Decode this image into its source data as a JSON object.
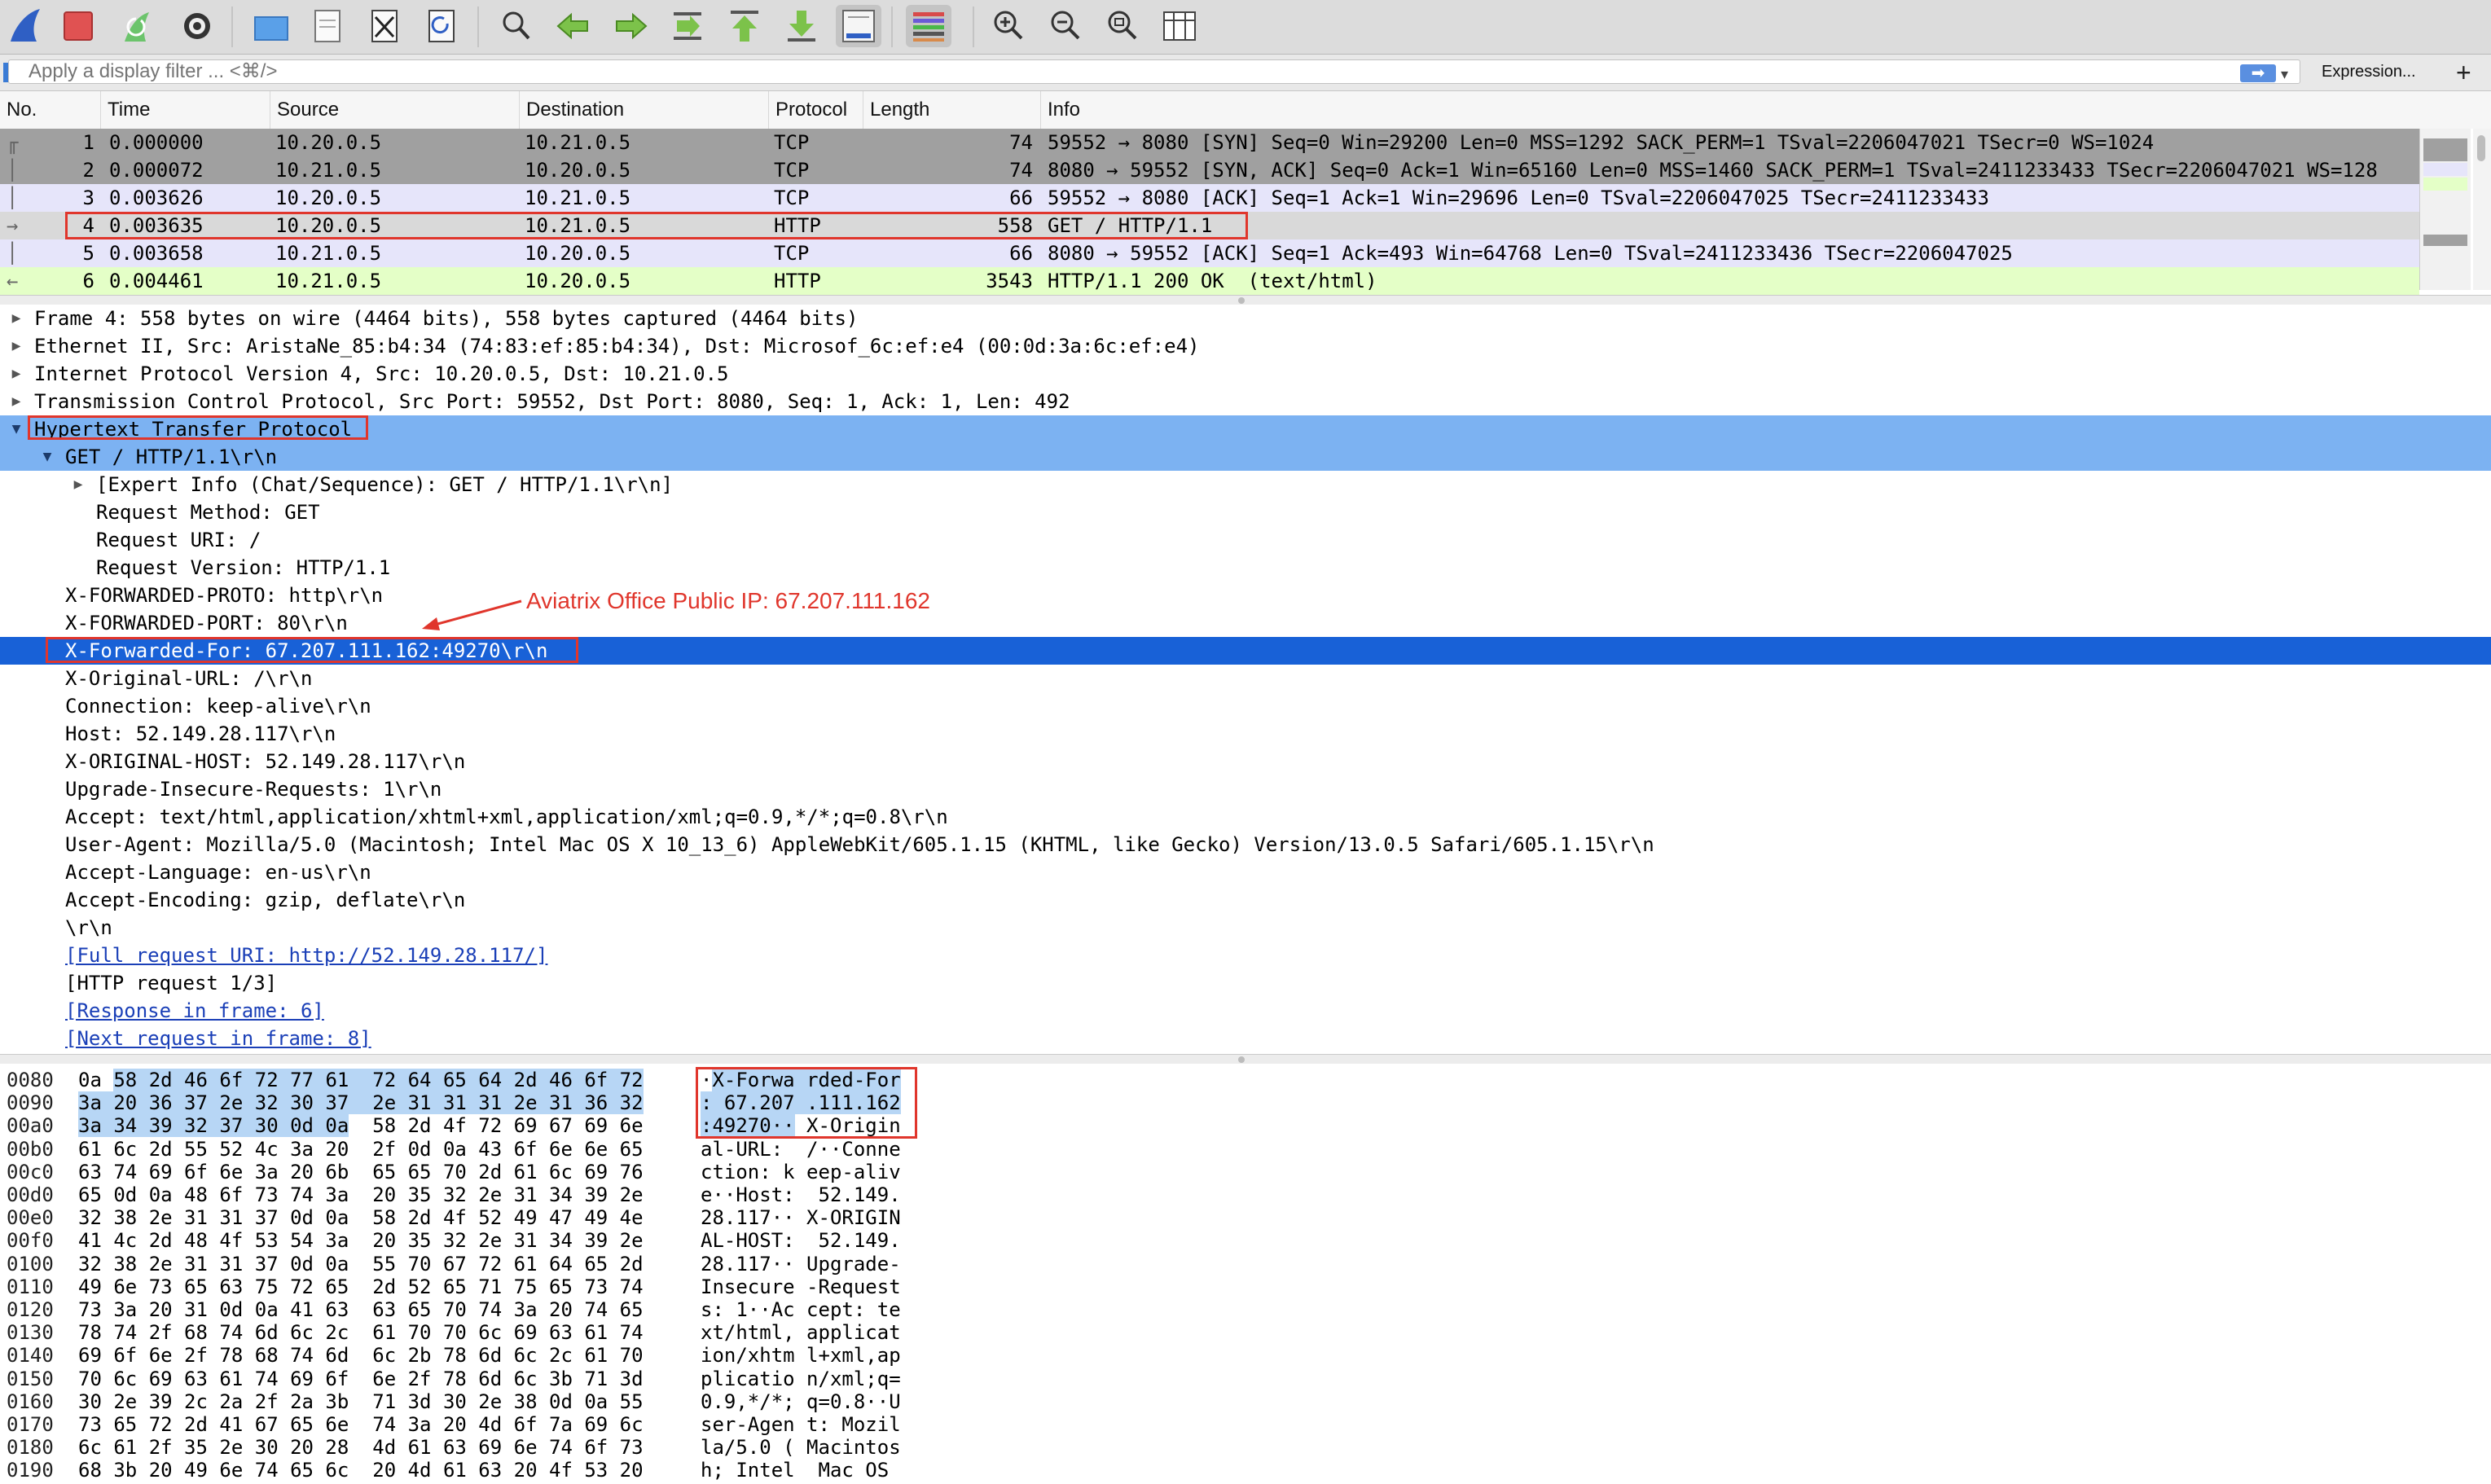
{
  "toolbar": {
    "buttons": [
      {
        "name": "shark-fin-start-icon"
      },
      {
        "name": "stop-capture-icon"
      },
      {
        "name": "restart-capture-icon"
      },
      {
        "name": "capture-options-icon"
      },
      {
        "name": "open-file-icon"
      },
      {
        "name": "save-file-icon"
      },
      {
        "name": "close-file-icon"
      },
      {
        "name": "reload-file-icon"
      },
      {
        "name": "find-packet-icon"
      },
      {
        "name": "go-back-icon"
      },
      {
        "name": "go-forward-icon"
      },
      {
        "name": "go-to-packet-icon"
      },
      {
        "name": "first-packet-icon"
      },
      {
        "name": "last-packet-icon"
      },
      {
        "name": "autoscroll-icon"
      },
      {
        "name": "colorize-icon"
      },
      {
        "name": "zoom-in-icon"
      },
      {
        "name": "zoom-out-icon"
      },
      {
        "name": "normal-size-icon"
      },
      {
        "name": "resize-columns-icon"
      }
    ]
  },
  "filter": {
    "placeholder": "Apply a display filter ... <⌘/>",
    "apply_label": "➡",
    "dropdown": "▾",
    "expression_label": "Expression...",
    "add_label": "+"
  },
  "packet_list": {
    "columns": [
      "No.",
      "Time",
      "Source",
      "Destination",
      "Protocol",
      "Length",
      "Info"
    ],
    "rows": [
      {
        "no": "1",
        "time": "0.000000",
        "src": "10.20.0.5",
        "dst": "10.21.0.5",
        "proto": "TCP",
        "len": "74",
        "info": "59552 → 8080 [SYN] Seq=0 Win=29200 Len=0 MSS=1292 SACK_PERM=1 TSval=2206047021 TSecr=0 WS=1024",
        "bg": "#a0a0a0",
        "marker": "╓"
      },
      {
        "no": "2",
        "time": "0.000072",
        "src": "10.21.0.5",
        "dst": "10.20.0.5",
        "proto": "TCP",
        "len": "74",
        "info": "8080 → 59552 [SYN, ACK] Seq=0 Ack=1 Win=65160 Len=0 MSS=1460 SACK_PERM=1 TSval=2411233433 TSecr=2206047021 WS=128",
        "bg": "#a0a0a0",
        "marker": "│"
      },
      {
        "no": "3",
        "time": "0.003626",
        "src": "10.20.0.5",
        "dst": "10.21.0.5",
        "proto": "TCP",
        "len": "66",
        "info": "59552 → 8080 [ACK] Seq=1 Ack=1 Win=29696 Len=0 TSval=2206047025 TSecr=2411233433",
        "bg": "#e6e5fa",
        "marker": "│"
      },
      {
        "no": "4",
        "time": "0.003635",
        "src": "10.20.0.5",
        "dst": "10.21.0.5",
        "proto": "HTTP",
        "len": "558",
        "info": "GET / HTTP/1.1",
        "bg": "#d9d9d9",
        "marker": "→"
      },
      {
        "no": "5",
        "time": "0.003658",
        "src": "10.21.0.5",
        "dst": "10.20.0.5",
        "proto": "TCP",
        "len": "66",
        "info": "8080 → 59552 [ACK] Seq=1 Ack=493 Win=64768 Len=0 TSval=2411233436 TSecr=2206047025",
        "bg": "#e6e5fa",
        "marker": "│"
      },
      {
        "no": "6",
        "time": "0.004461",
        "src": "10.21.0.5",
        "dst": "10.20.0.5",
        "proto": "HTTP",
        "len": "3543",
        "info": "HTTP/1.1 200 OK  (text/html)",
        "bg": "#e4ffc7",
        "marker": "←"
      }
    ]
  },
  "details": [
    {
      "indent": 0,
      "tri": "▶",
      "text": "Frame 4: 558 bytes on wire (4464 bits), 558 bytes captured (4464 bits)"
    },
    {
      "indent": 0,
      "tri": "▶",
      "text": "Ethernet II, Src: AristaNe_85:b4:34 (74:83:ef:85:b4:34), Dst: Microsof_6c:ef:e4 (00:0d:3a:6c:ef:e4)"
    },
    {
      "indent": 0,
      "tri": "▶",
      "text": "Internet Protocol Version 4, Src: 10.20.0.5, Dst: 10.21.0.5"
    },
    {
      "indent": 0,
      "tri": "▶",
      "text": "Transmission Control Protocol, Src Port: 59552, Dst Port: 8080, Seq: 1, Ack: 1, Len: 492"
    },
    {
      "indent": 0,
      "tri": "▼",
      "text": "Hypertext Transfer Protocol",
      "sel": "sel1"
    },
    {
      "indent": 1,
      "tri": "▼",
      "text": "GET / HTTP/1.1\\r\\n",
      "sel": "sel1"
    },
    {
      "indent": 2,
      "tri": "▶",
      "text": "[Expert Info (Chat/Sequence): GET / HTTP/1.1\\r\\n]"
    },
    {
      "indent": 2,
      "tri": "",
      "text": "Request Method: GET"
    },
    {
      "indent": 2,
      "tri": "",
      "text": "Request URI: /"
    },
    {
      "indent": 2,
      "tri": "",
      "text": "Request Version: HTTP/1.1"
    },
    {
      "indent": 1,
      "tri": "",
      "text": "X-FORWARDED-PROTO: http\\r\\n"
    },
    {
      "indent": 1,
      "tri": "",
      "text": "X-FORWARDED-PORT: 80\\r\\n"
    },
    {
      "indent": 1,
      "tri": "",
      "text": "X-Forwarded-For: 67.207.111.162:49270\\r\\n",
      "sel": "sel2"
    },
    {
      "indent": 1,
      "tri": "",
      "text": "X-Original-URL: /\\r\\n"
    },
    {
      "indent": 1,
      "tri": "",
      "text": "Connection: keep-alive\\r\\n"
    },
    {
      "indent": 1,
      "tri": "",
      "text": "Host: 52.149.28.117\\r\\n"
    },
    {
      "indent": 1,
      "tri": "",
      "text": "X-ORIGINAL-HOST: 52.149.28.117\\r\\n"
    },
    {
      "indent": 1,
      "tri": "",
      "text": "Upgrade-Insecure-Requests: 1\\r\\n"
    },
    {
      "indent": 1,
      "tri": "",
      "text": "Accept: text/html,application/xhtml+xml,application/xml;q=0.9,*/*;q=0.8\\r\\n"
    },
    {
      "indent": 1,
      "tri": "",
      "text": "User-Agent: Mozilla/5.0 (Macintosh; Intel Mac OS X 10_13_6) AppleWebKit/605.1.15 (KHTML, like Gecko) Version/13.0.5 Safari/605.1.15\\r\\n"
    },
    {
      "indent": 1,
      "tri": "",
      "text": "Accept-Language: en-us\\r\\n"
    },
    {
      "indent": 1,
      "tri": "",
      "text": "Accept-Encoding: gzip, deflate\\r\\n"
    },
    {
      "indent": 1,
      "tri": "",
      "text": "\\r\\n"
    },
    {
      "indent": 1,
      "tri": "",
      "text": "[Full request URI: http://52.149.28.117/]",
      "link": true
    },
    {
      "indent": 1,
      "tri": "",
      "text": "[HTTP request 1/3]"
    },
    {
      "indent": 1,
      "tri": "",
      "text": "[Response in frame: 6]",
      "link": true
    },
    {
      "indent": 1,
      "tri": "",
      "text": "[Next request in frame: 8]",
      "link": true
    }
  ],
  "annotation": "Aviatrix Office Public IP: 67.207.111.162",
  "hex": [
    {
      "off": "0080",
      "a": "0a",
      "ah": "58 2d 46 6f 72 77 61",
      "b": "72 64 65 64 2d 46 6f 72",
      "hb": true,
      "ascA": "·",
      "ascAh": "X-Forwa",
      "ascB": "rded-For",
      "hbb": true
    },
    {
      "off": "0090",
      "a": "",
      "ah": "3a 20 36 37 2e 32 30 37",
      "b": "2e 31 31 31 2e 31 36 32",
      "hb": true,
      "ascA": "",
      "ascAh": ": 67.207",
      "ascB": ".111.162",
      "hbb": true
    },
    {
      "off": "00a0",
      "a": "",
      "ah": "3a 34 39 32 37 30 0d 0a",
      "b": "58 2d 4f 72 69 67 69 6e",
      "hb": false,
      "ascA": "",
      "ascAh": ":49270··",
      "ascB": "X-Origin",
      "hbb": false
    },
    {
      "off": "00b0",
      "a": "61 6c 2d 55 52 4c 3a 20",
      "ah": "",
      "b": "2f 0d 0a 43 6f 6e 6e 65",
      "ascA": "al-URL: ",
      "ascAh": "",
      "ascB": "/··Conne"
    },
    {
      "off": "00c0",
      "a": "63 74 69 6f 6e 3a 20 6b",
      "ah": "",
      "b": "65 65 70 2d 61 6c 69 76",
      "ascA": "ction: k",
      "ascAh": "",
      "ascB": "eep-aliv"
    },
    {
      "off": "00d0",
      "a": "65 0d 0a 48 6f 73 74 3a",
      "ah": "",
      "b": "20 35 32 2e 31 34 39 2e",
      "ascA": "e··Host:",
      "ascAh": "",
      "ascB": " 52.149."
    },
    {
      "off": "00e0",
      "a": "32 38 2e 31 31 37 0d 0a",
      "ah": "",
      "b": "58 2d 4f 52 49 47 49 4e",
      "ascA": "28.117··",
      "ascAh": "",
      "ascB": "X-ORIGIN"
    },
    {
      "off": "00f0",
      "a": "41 4c 2d 48 4f 53 54 3a",
      "ah": "",
      "b": "20 35 32 2e 31 34 39 2e",
      "ascA": "AL-HOST:",
      "ascAh": "",
      "ascB": " 52.149."
    },
    {
      "off": "0100",
      "a": "32 38 2e 31 31 37 0d 0a",
      "ah": "",
      "b": "55 70 67 72 61 64 65 2d",
      "ascA": "28.117··",
      "ascAh": "",
      "ascB": "Upgrade-"
    },
    {
      "off": "0110",
      "a": "49 6e 73 65 63 75 72 65",
      "ah": "",
      "b": "2d 52 65 71 75 65 73 74",
      "ascA": "Insecure",
      "ascAh": "",
      "ascB": "-Request"
    },
    {
      "off": "0120",
      "a": "73 3a 20 31 0d 0a 41 63",
      "ah": "",
      "b": "63 65 70 74 3a 20 74 65",
      "ascA": "s: 1··Ac",
      "ascAh": "",
      "ascB": "cept: te"
    },
    {
      "off": "0130",
      "a": "78 74 2f 68 74 6d 6c 2c",
      "ah": "",
      "b": "61 70 70 6c 69 63 61 74",
      "ascA": "xt/html,",
      "ascAh": "",
      "ascB": "applicat"
    },
    {
      "off": "0140",
      "a": "69 6f 6e 2f 78 68 74 6d",
      "ah": "",
      "b": "6c 2b 78 6d 6c 2c 61 70",
      "ascA": "ion/xhtm",
      "ascAh": "",
      "ascB": "l+xml,ap"
    },
    {
      "off": "0150",
      "a": "70 6c 69 63 61 74 69 6f",
      "ah": "",
      "b": "6e 2f 78 6d 6c 3b 71 3d",
      "ascA": "plicatio",
      "ascAh": "",
      "ascB": "n/xml;q="
    },
    {
      "off": "0160",
      "a": "30 2e 39 2c 2a 2f 2a 3b",
      "ah": "",
      "b": "71 3d 30 2e 38 0d 0a 55",
      "ascA": "0.9,*/*;",
      "ascAh": "",
      "ascB": "q=0.8··U"
    },
    {
      "off": "0170",
      "a": "73 65 72 2d 41 67 65 6e",
      "ah": "",
      "b": "74 3a 20 4d 6f 7a 69 6c",
      "ascA": "ser-Agen",
      "ascAh": "",
      "ascB": "t: Mozil"
    },
    {
      "off": "0180",
      "a": "6c 61 2f 35 2e 30 20 28",
      "ah": "",
      "b": "4d 61 63 69 6e 74 6f 73",
      "ascA": "la/5.0 (",
      "ascAh": "",
      "ascB": "Macintos"
    },
    {
      "off": "0190",
      "a": "68 3b 20 49 6e 74 65 6c",
      "ah": "",
      "b": "20 4d 61 63 20 4f 53 20",
      "ascA": "h; Intel",
      "ascAh": "",
      "ascB": " Mac OS "
    }
  ],
  "colors": {
    "selected_row": "#1861d7",
    "protocol_highlight": "#7cb2f2",
    "annotation": "#e0362c",
    "hex_highlight": "#b7d6f5"
  }
}
